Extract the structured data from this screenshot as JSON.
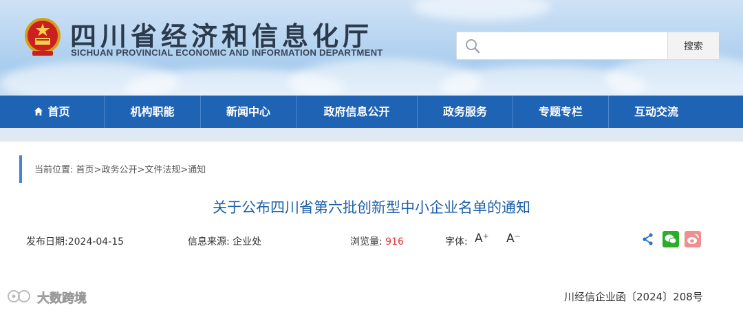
{
  "header": {
    "site_title": "四川省经济和信息化厅",
    "site_subtitle": "SICHUAN PROVINCIAL ECONOMIC AND INFORMATION DEPARTMENT",
    "search": {
      "placeholder": "",
      "button_label": "搜索"
    }
  },
  "nav": {
    "items": [
      {
        "label": "首页",
        "icon": "home-icon"
      },
      {
        "label": "机构职能"
      },
      {
        "label": "新闻中心"
      },
      {
        "label": "政府信息公开"
      },
      {
        "label": "政务服务"
      },
      {
        "label": "专题专栏"
      },
      {
        "label": "互动交流"
      }
    ]
  },
  "breadcrumb": {
    "prefix": "当前位置:",
    "items": [
      "首页",
      "政务公开",
      "文件法规",
      "通知"
    ],
    "separator": ">"
  },
  "article": {
    "title": "关于公布四川省第六批创新型中小企业名单的通知",
    "publish_date": "发布日期:2024-04-15",
    "source": "信息来源:  企业处",
    "views_label": "浏览量:",
    "views_value": "916",
    "font_label": "字体:",
    "font_increase": "A⁺",
    "font_decrease": "A⁻",
    "doc_number": "川经信企业函〔2024〕208号"
  },
  "share": {
    "icons": [
      "share-icon",
      "wechat-icon",
      "weibo-icon"
    ],
    "colors": {
      "share": "#2a6fc9",
      "wechat": "#2aae2a",
      "weibo": "#f08f8f"
    }
  },
  "watermark": {
    "text": "大数跨境"
  },
  "colors": {
    "nav_bg": "#1f63b5",
    "title_blue": "#1d5fa8",
    "accent_bar": "#3f86cf",
    "views_red": "#d33333"
  }
}
